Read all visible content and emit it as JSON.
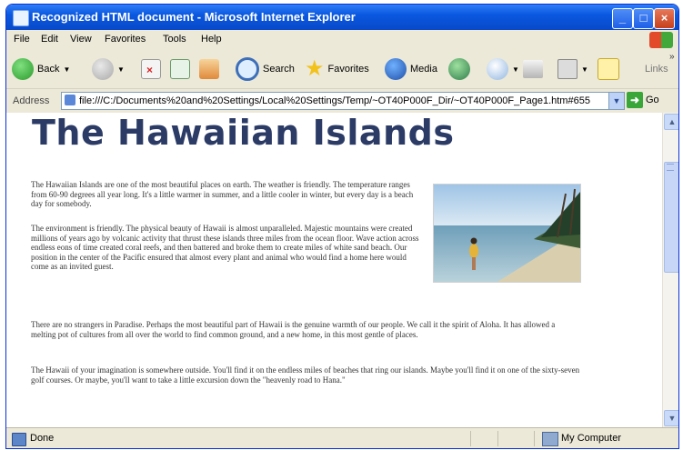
{
  "window": {
    "title": "Recognized HTML document - Microsoft Internet Explorer"
  },
  "menu": [
    "File",
    "Edit",
    "View",
    "Favorites",
    "Tools",
    "Help"
  ],
  "toolbar": {
    "back_label": "Back",
    "search_label": "Search",
    "favorites_label": "Favorites",
    "media_label": "Media",
    "links_label": "Links"
  },
  "address": {
    "label": "Address",
    "url": "file:///C:/Documents%20and%20Settings/Local%20Settings/Temp/~OT40P000F_Dir/~OT40P000F_Page1.htm#655",
    "go_label": "Go"
  },
  "page": {
    "heading": "The Hawaiian Islands",
    "paragraphs": [
      "The Hawaiian Islands are one of the most beautiful places on earth. The weather is friendly. The temperature ranges from 60-90 degrees all year long. It's a little warmer in summer, and a little cooler in winter, but every day is a beach day for somebody.",
      "The environment is friendly. The physical beauty of Hawaii is almost unparalleled. Majestic mountains were created millions of years ago by volcanic activity that thrust these islands three miles from the ocean floor. Wave action across endless eons of time created coral reefs, and then battered and broke them to create miles of white sand beach. Our position in the center of the Pacific ensured that almost every plant and animal who would find a home here would come as an invited guest.",
      "There are no strangers in Paradise. Perhaps the most beautiful part of Hawaii is the genuine warmth of our people. We call it the spirit of Aloha. It has allowed a melting pot of cultures from all over the world to find common ground, and a new home, in this most gentle of places.",
      "The Hawaii of your imagination is somewhere outside. You'll find it on the endless miles of beaches that ring our islands. Maybe you'll find it on one of the sixty-seven golf courses. Or maybe, you'll want to take a little excursion down the \"heavenly road to Hana.\""
    ]
  },
  "status": {
    "text": "Done",
    "zone": "My Computer"
  },
  "colors": {
    "title_bar": "#0a58e0",
    "heading": "#2b3b66",
    "chrome": "#ece9d8"
  }
}
